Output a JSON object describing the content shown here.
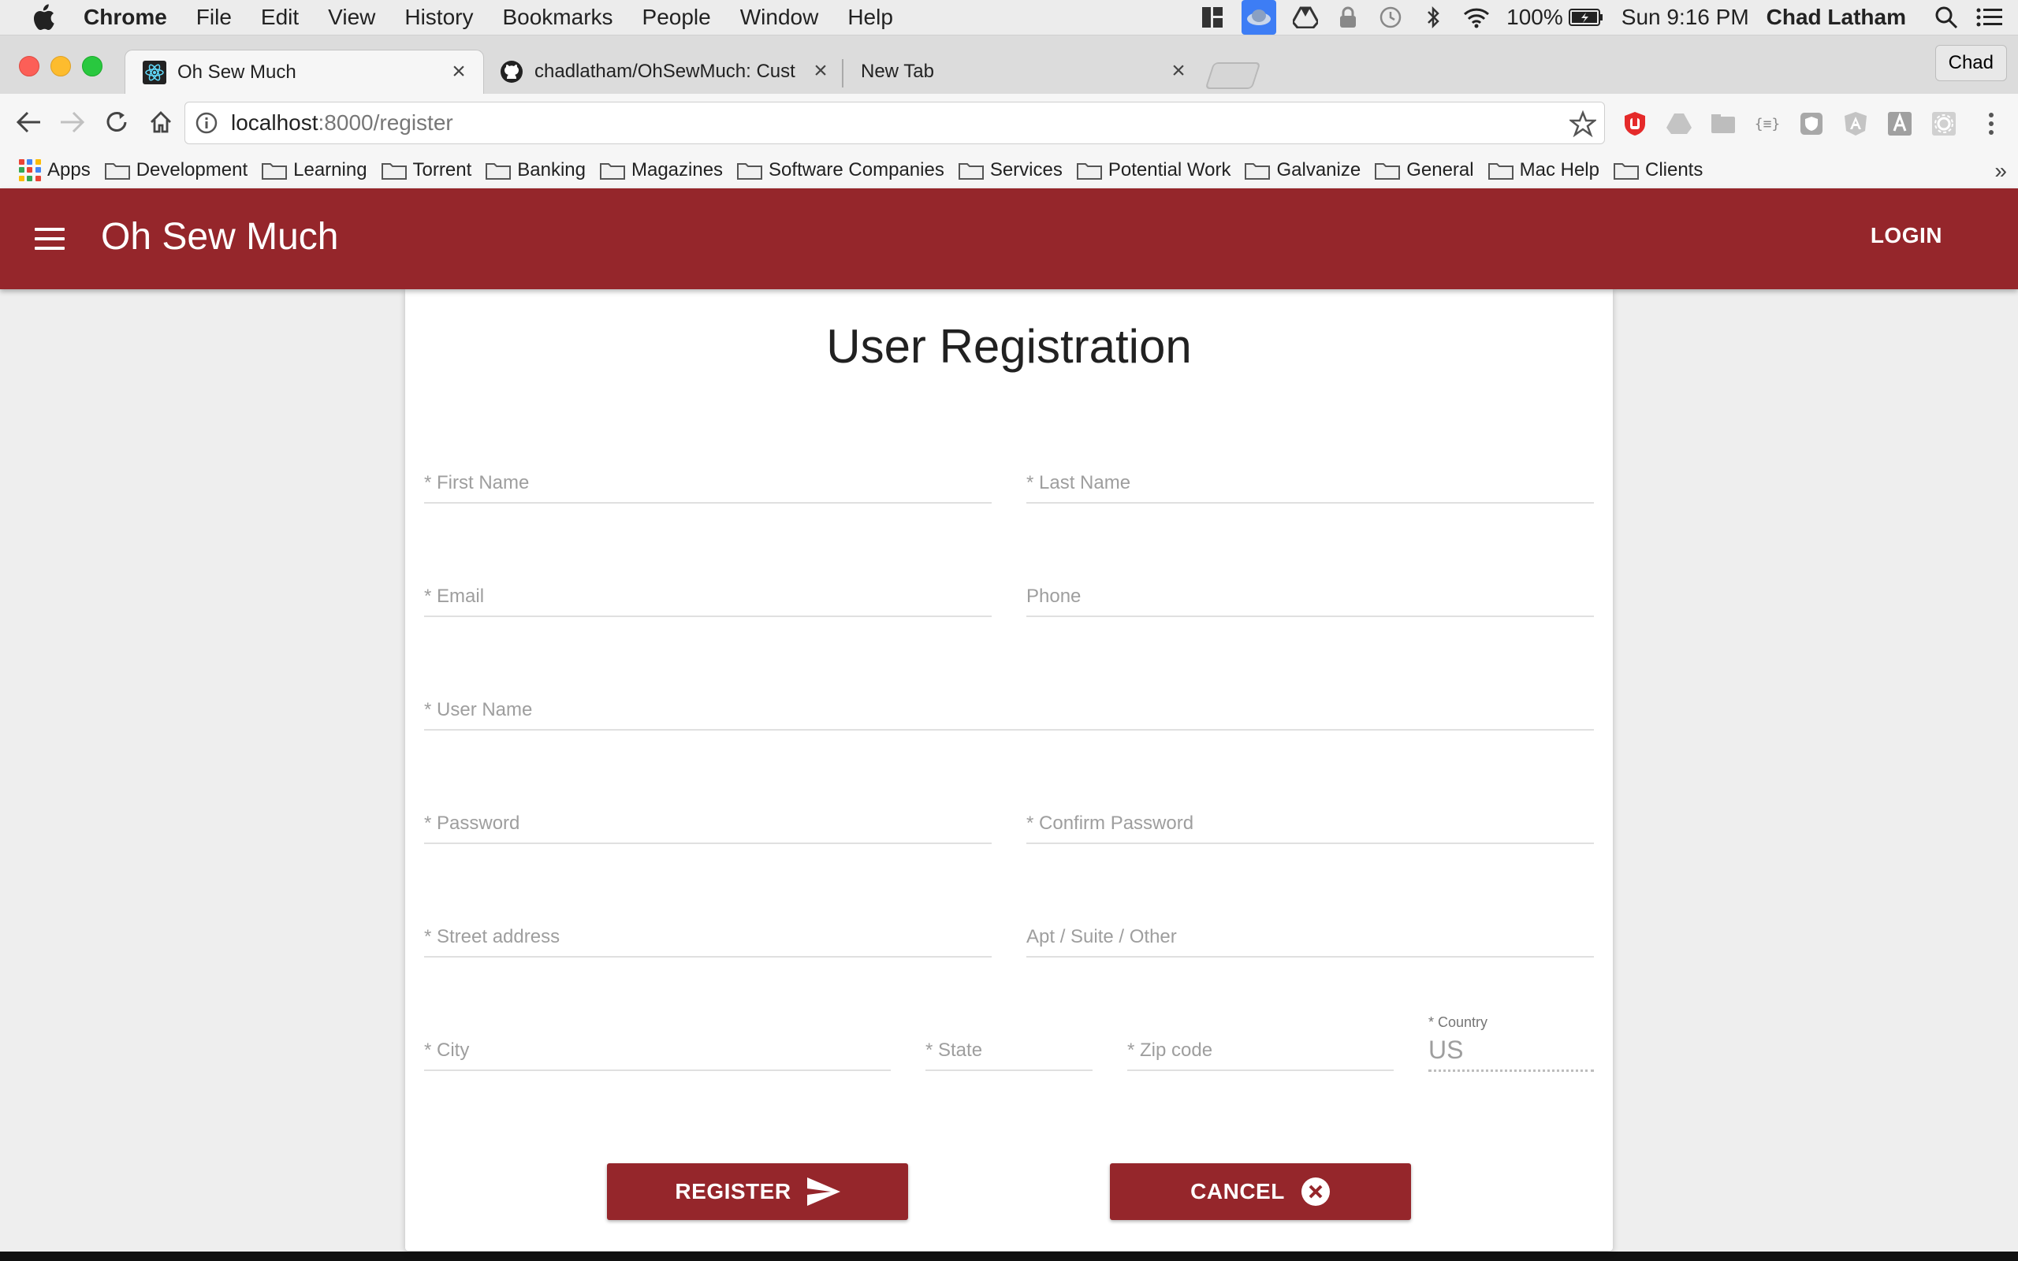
{
  "menubar": {
    "app_name": "Chrome",
    "items": [
      "File",
      "Edit",
      "View",
      "History",
      "Bookmarks",
      "People",
      "Window",
      "Help"
    ],
    "battery": "100%",
    "clock": "Sun 9:16 PM",
    "user": "Chad Latham"
  },
  "tabs": [
    {
      "title": "Oh Sew Much",
      "close": "×"
    },
    {
      "title": "chadlatham/OhSewMuch: Cust",
      "close": "×"
    },
    {
      "title": "New Tab",
      "close": "×"
    }
  ],
  "profile": "Chad",
  "omnibox": {
    "host": "localhost",
    "path": ":8000/register"
  },
  "bookmarks": {
    "apps": "Apps",
    "folders": [
      "Development",
      "Learning",
      "Torrent",
      "Banking",
      "Magazines",
      "Software Companies",
      "Services",
      "Potential Work",
      "Galvanize",
      "General",
      "Mac Help",
      "Clients"
    ],
    "more": "»"
  },
  "appbar": {
    "title": "Oh Sew Much",
    "login": "LOGIN"
  },
  "form": {
    "title": "User Registration",
    "fields": {
      "first_name": "* First Name",
      "last_name": "* Last Name",
      "email": "* Email",
      "phone": "Phone",
      "username": "* User Name",
      "password": "* Password",
      "confirm_password": "* Confirm Password",
      "street": "* Street address",
      "apt": "Apt / Suite / Other",
      "city": "* City",
      "state": "* State",
      "zip": "* Zip code",
      "country_label": "* Country",
      "country_value": "US"
    },
    "register": "REGISTER",
    "cancel": "CANCEL"
  },
  "colors": {
    "brand": "#95262b",
    "background": "#eeeeee"
  }
}
